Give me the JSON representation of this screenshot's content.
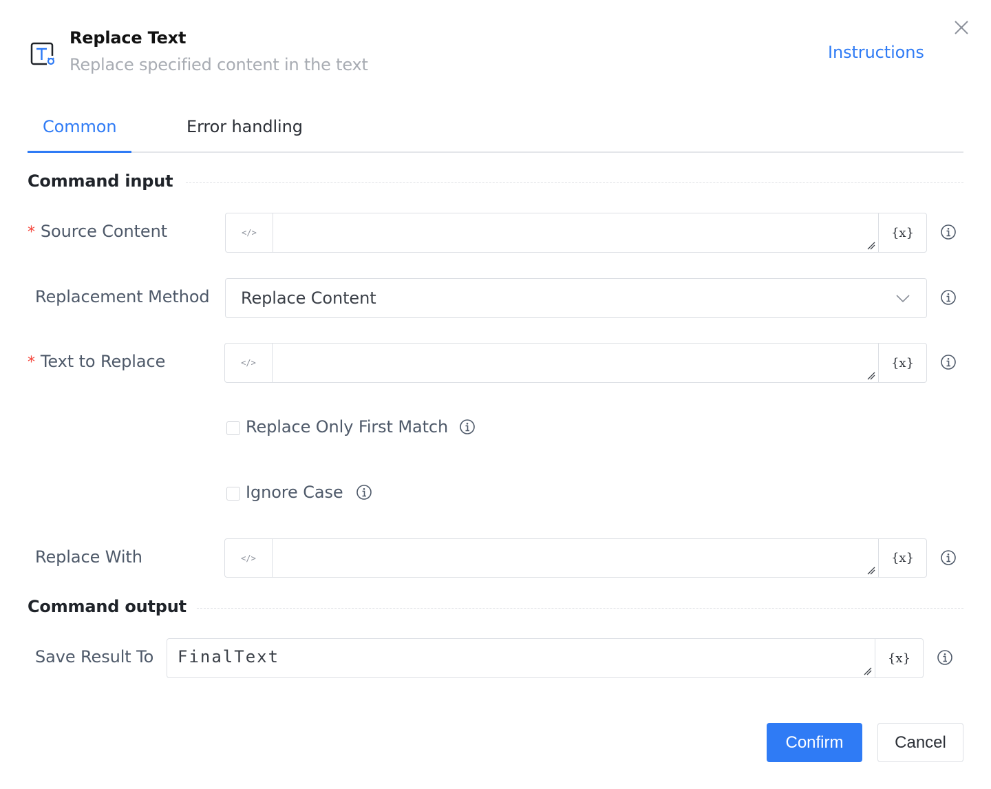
{
  "dialog": {
    "title": "Replace Text",
    "subtitle": "Replace specified content in the text",
    "instructions_link": "Instructions",
    "header_icon": "text-replace-icon",
    "close_icon": "close-icon"
  },
  "tabs": [
    {
      "label": "Common",
      "active": true
    },
    {
      "label": "Error handling",
      "active": false
    }
  ],
  "sections": {
    "input_title": "Command input",
    "output_title": "Command output"
  },
  "fields": {
    "source_content": {
      "label": "Source Content",
      "required_mark": "*",
      "value": "",
      "code_icon": "</>",
      "var_icon": "{x}"
    },
    "replacement_method": {
      "label": "Replacement Method",
      "value": "Replace Content"
    },
    "text_to_replace": {
      "label": "Text to Replace",
      "required_mark": "*",
      "value": "",
      "code_icon": "</>",
      "var_icon": "{x}"
    },
    "replace_only_first_match": {
      "label": "Replace Only First Match",
      "checked": false
    },
    "ignore_case": {
      "label": "Ignore Case",
      "checked": false
    },
    "replace_with": {
      "label": "Replace With",
      "value": "",
      "code_icon": "</>",
      "var_icon": "{x}"
    },
    "save_result_to": {
      "label": "Save Result To",
      "value": "FinalText",
      "var_icon": "{x}"
    }
  },
  "buttons": {
    "confirm": "Confirm",
    "cancel": "Cancel"
  },
  "colors": {
    "accent": "#2f7bf5",
    "required": "#f5453b",
    "label": "#4e5969",
    "border": "#dcdfe4"
  }
}
